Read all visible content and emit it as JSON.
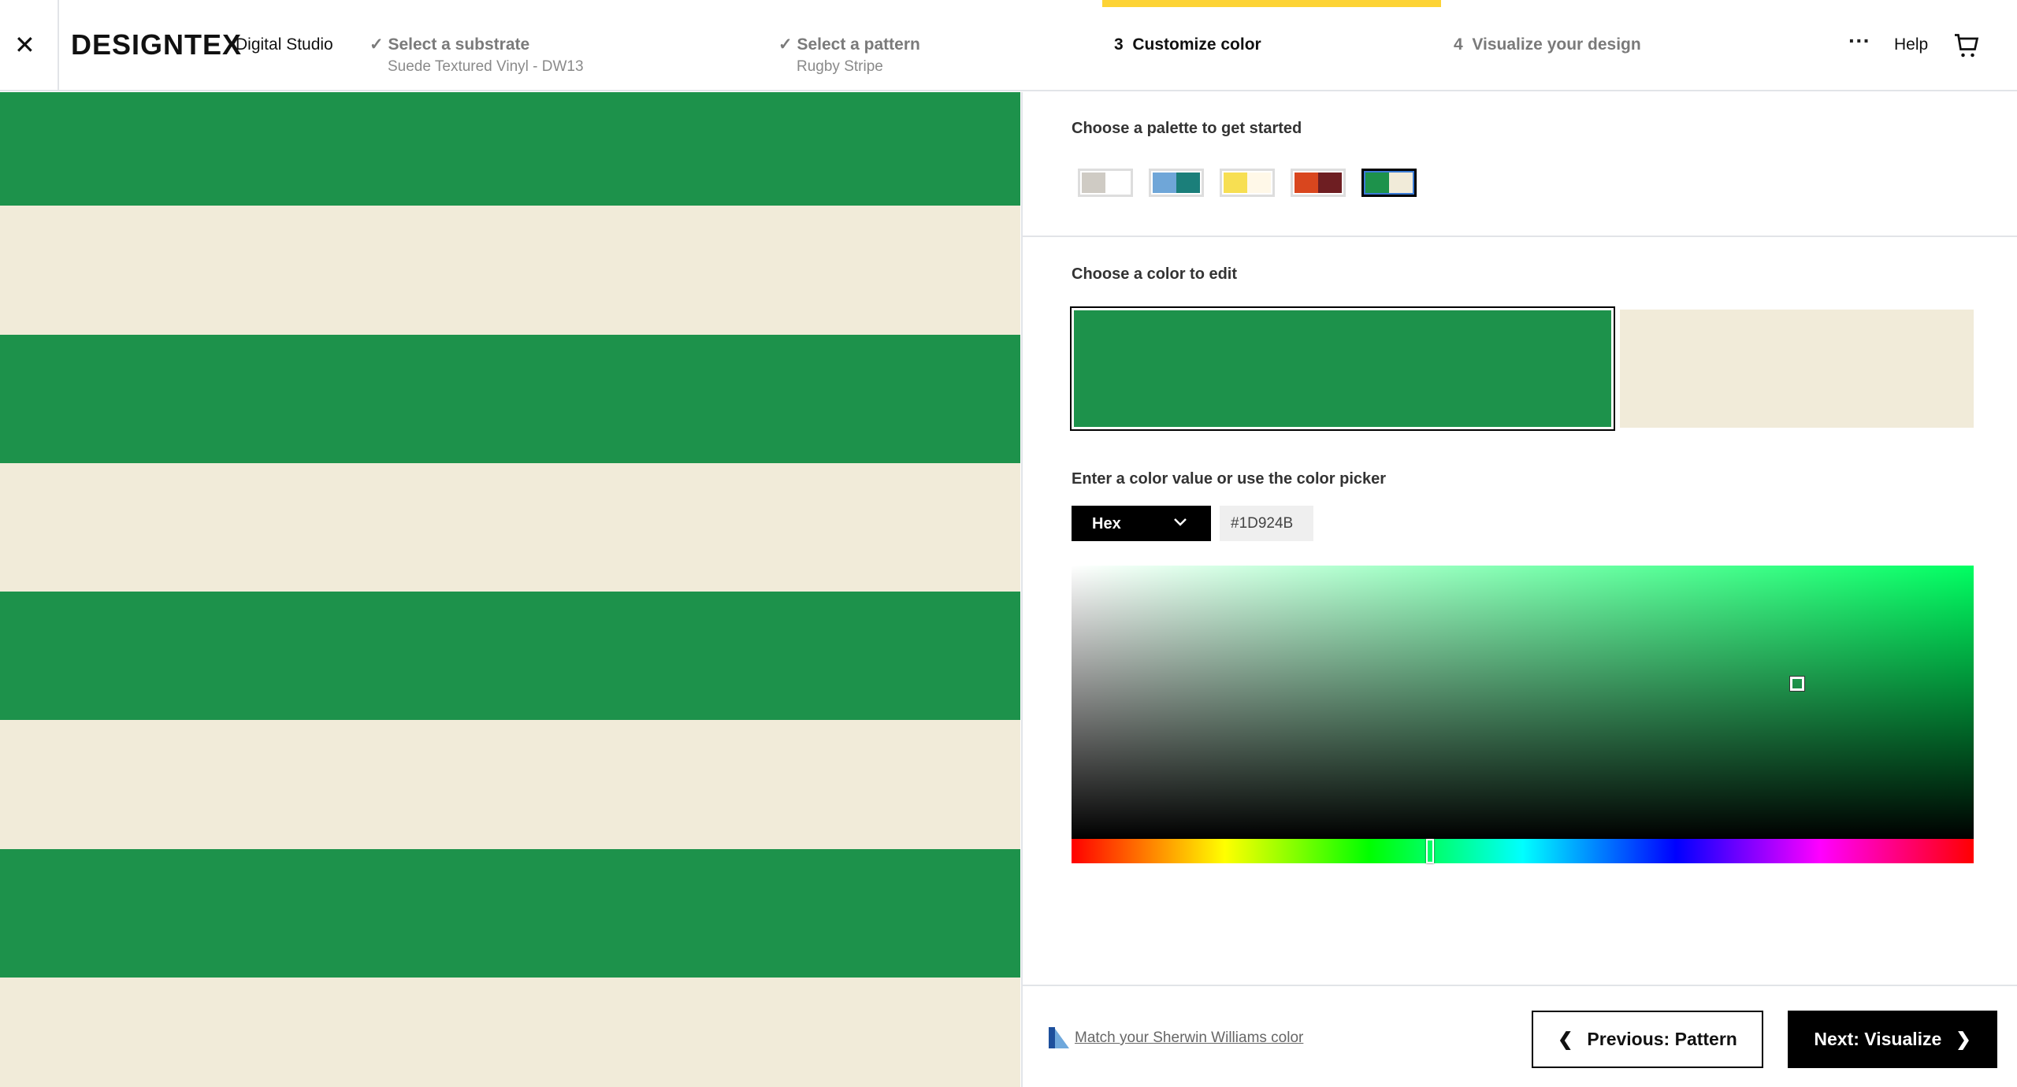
{
  "header": {
    "logo": "DESIGNTEX",
    "product": "Digital Studio",
    "steps": [
      {
        "number": "",
        "label": "Select a substrate",
        "sub": "Suede Textured Vinyl - DW13",
        "done": true
      },
      {
        "number": "",
        "label": "Select a pattern",
        "sub": "Rugby Stripe",
        "done": true
      },
      {
        "number": "3",
        "label": "Customize color",
        "active": true
      },
      {
        "number": "4",
        "label": "Visualize your design"
      }
    ],
    "more": "···",
    "help": "Help"
  },
  "colors": {
    "green": "#1D924B",
    "cream": "#F1EBD9",
    "accent": "#FDD335"
  },
  "palette": {
    "title": "Choose a palette to get started",
    "options": [
      [
        "#CFCBC4",
        "#FFFFFF"
      ],
      [
        "#6FA6D8",
        "#1B7F7A"
      ],
      [
        "#F7DF52",
        "#FFF8E8"
      ],
      [
        "#D9461E",
        "#6E1E22"
      ],
      [
        "#1D924B",
        "#F1EBD9"
      ]
    ],
    "selected": 4
  },
  "edit": {
    "title": "Choose a color to edit",
    "selected": 0
  },
  "picker": {
    "title": "Enter a color value or use the color picker",
    "mode": "Hex",
    "value": "#1D924B",
    "hue": 143
  },
  "footer": {
    "sw_link": "Match your Sherwin Williams color",
    "prev": "Previous: Pattern",
    "next": "Next: Visualize"
  }
}
